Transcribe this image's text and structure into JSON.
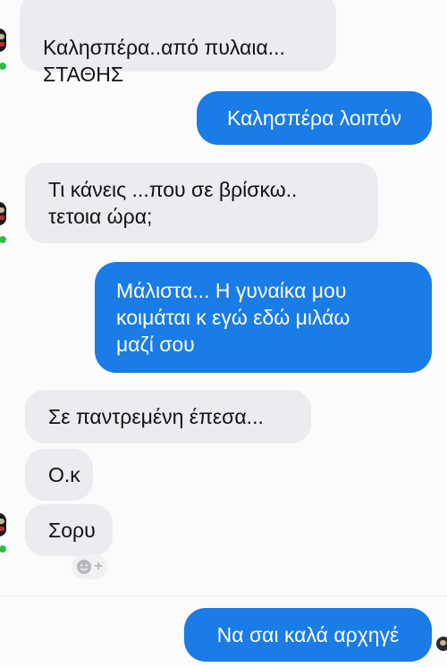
{
  "messages": [
    {
      "id": "m1",
      "direction": "incoming",
      "text": "Καλησπέρα..από πυλαια...\nΣΤΑΘΗΣ"
    },
    {
      "id": "m2",
      "direction": "outgoing",
      "text": "Καλησπέρα λοιπόν"
    },
    {
      "id": "m3",
      "direction": "incoming",
      "text": "Τι κάνεις ...που σε βρίσκω..\nτετοια ώρα;"
    },
    {
      "id": "m4",
      "direction": "outgoing",
      "text": "Μάλιστα... Η γυναίκα μου\nκοιμάται κ εγώ εδώ μιλάω\nμαζί σου"
    },
    {
      "id": "m5",
      "direction": "incoming",
      "text": "Σε παντρεμένη έπεσα..."
    },
    {
      "id": "m6",
      "direction": "incoming",
      "text": "Ο.κ"
    },
    {
      "id": "m7",
      "direction": "incoming",
      "text": "Σορυ"
    },
    {
      "id": "m8",
      "direction": "outgoing",
      "text": "Να σαι καλά αρχηγέ"
    }
  ],
  "react_button": {
    "icon": "smiley-add-icon",
    "plus": "+"
  },
  "colors": {
    "background": "#fbfbfb",
    "incoming_bubble": "#ecebf0",
    "outgoing_bubble": "#1a7ce6",
    "online_dot": "#2bbf4a"
  }
}
